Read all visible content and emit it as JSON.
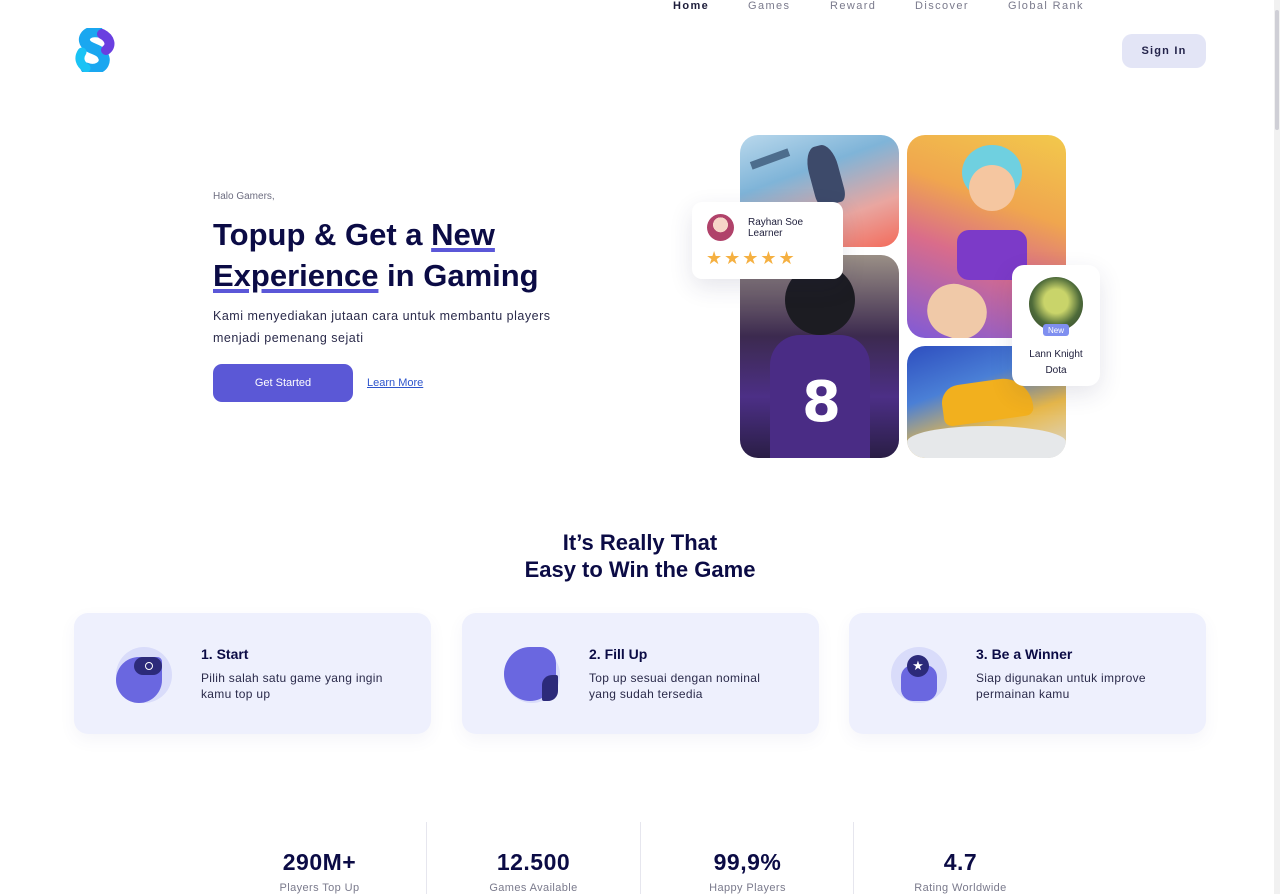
{
  "header": {
    "logo_icon": "brand-s-logo",
    "nav": [
      "Home",
      "Games",
      "Reward",
      "Discover",
      "Global Rank"
    ],
    "signin_label": "Sign In"
  },
  "hero": {
    "greeting": "Halo Gamers,",
    "headline_1": "Topup & Get a ",
    "headline_2": "New",
    "headline_3": "Experience",
    "headline_4": " in Gaming",
    "description": "Kami menyediakan jutaan cara untuk membantu players menjadi pemenang sejati",
    "primary_button": "Get Started",
    "secondary_link": "Learn More"
  },
  "review_card": {
    "name_line1": "Rayhan Soe",
    "name_line2": "Learner",
    "stars": "★★★★★",
    "rating": 5
  },
  "player_card": {
    "badge": "New",
    "name": "Lann Knight",
    "game": "Dota"
  },
  "steps_section": {
    "title_line1": "It’s Really That",
    "title_line2": "Easy to Win the Game",
    "steps": [
      {
        "title": "1. Start",
        "text": "Pilih salah satu game yang ingin kamu top up",
        "icon": "gamepad-icon"
      },
      {
        "title": "2. Fill Up",
        "text": "Top up sesuai dengan nominal yang sudah tersedia",
        "icon": "wallet-icon"
      },
      {
        "title": "3. Be a Winner",
        "text": "Siap digunakan untuk improve permainan kamu",
        "icon": "trophy-star-icon"
      }
    ]
  },
  "stats": [
    {
      "value": "290M+",
      "label": "Players Top Up"
    },
    {
      "value": "12.500",
      "label": "Games Available"
    },
    {
      "value": "99,9%",
      "label": "Happy Players"
    },
    {
      "value": "4.7",
      "label": "Rating Worldwide"
    }
  ],
  "colors": {
    "primary": "#5b58d6",
    "navy": "#0b0b45",
    "card_bg": "#eef0fd",
    "star": "#f5b041"
  }
}
